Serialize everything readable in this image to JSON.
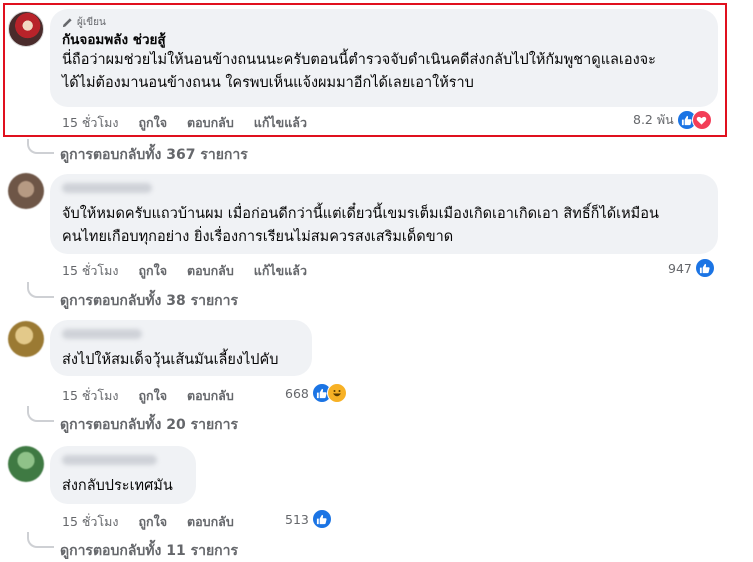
{
  "comments": [
    {
      "is_author": true,
      "author_badge": "ผู้เขียน",
      "name": "กันจอมพลัง ช่วยสู้",
      "lines": [
        "นี่ถือว่าผมช่วยไม่ให้นอนข้างถนนนะครับตอนนี้ตำรวจจับดำเนินคดีส่งกลับไปให้กัมพูชาดูแลเองจะ",
        "ได้ไม่ต้องมานอนข้างถนน ใครพบเห็นแจ้งผมมาอีกได้เลยเอาให้ราบ"
      ],
      "time": "15 ชั่วโมง",
      "like": "ถูกใจ",
      "reply": "ตอบกลับ",
      "edited": "แก้ไขแล้ว",
      "reaction_count": "8.2 พัน",
      "reactions": [
        "like",
        "love"
      ],
      "view_replies": "ดูการตอบกลับทั้ง 367 รายการ"
    },
    {
      "is_author": false,
      "lines": [
        "จับให้หมดครับแถวบ้านผม เมื่อก่อนดีกว่านี้แต่เดี๋ยวนี้เขมรเต็มเมืองเกิดเอาเกิดเอา สิทธิ์ก็ได้เหมือน",
        "คนไทยเกือบทุกอย่าง ยิ่งเรื่องการเรียนไม่สมควรสงเสริมเด็ดขาด"
      ],
      "time": "15 ชั่วโมง",
      "like": "ถูกใจ",
      "reply": "ตอบกลับ",
      "edited": "แก้ไขแล้ว",
      "reaction_count": "947",
      "reactions": [
        "like"
      ],
      "view_replies": "ดูการตอบกลับทั้ง 38 รายการ"
    },
    {
      "is_author": false,
      "lines": [
        "ส่งไปให้สมเด็จวุ้นเส้นมันเลี้ยงไปคับ"
      ],
      "time": "15 ชั่วโมง",
      "like": "ถูกใจ",
      "reply": "ตอบกลับ",
      "reaction_count": "668",
      "reactions": [
        "like",
        "haha"
      ],
      "view_replies": "ดูการตอบกลับทั้ง 20 รายการ"
    },
    {
      "is_author": false,
      "lines": [
        "ส่งกลับประเทศมัน"
      ],
      "time": "15 ชั่วโมง",
      "like": "ถูกใจ",
      "reply": "ตอบกลับ",
      "reaction_count": "513",
      "reactions": [
        "like"
      ],
      "view_replies": "ดูการตอบกลับทั้ง 11 รายการ"
    }
  ],
  "colors": {
    "like": "#1b74e4",
    "love": "#f33e58",
    "haha": "#f7b125",
    "highlight": "#e0101e",
    "bubble": "#f0f2f5"
  }
}
